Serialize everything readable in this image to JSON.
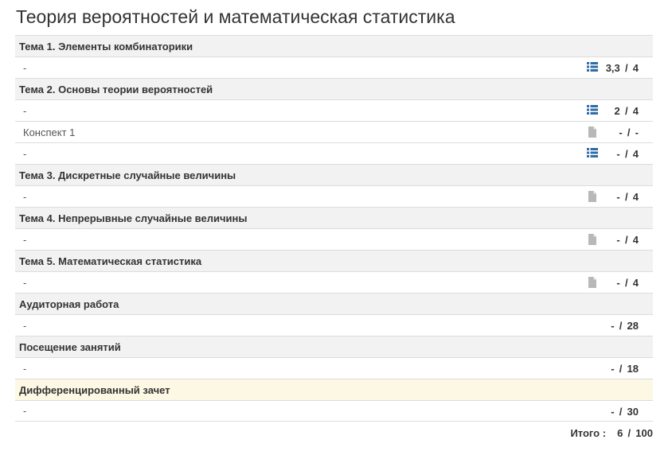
{
  "title": "Теория вероятностей и математическая статистика",
  "rows": [
    {
      "kind": "section",
      "label": "Тема 1. Элементы комбинаторики"
    },
    {
      "kind": "item",
      "label": "-",
      "icon": "list-icon",
      "got": "3,3",
      "max": "4"
    },
    {
      "kind": "section",
      "label": "Тема 2. Основы теории вероятностей"
    },
    {
      "kind": "item",
      "label": "-",
      "icon": "list-icon",
      "got": "2",
      "max": "4"
    },
    {
      "kind": "item",
      "label": "Конспект 1",
      "icon": "document-icon",
      "got": "-",
      "max": "-"
    },
    {
      "kind": "item",
      "label": "-",
      "icon": "list-icon",
      "got": "-",
      "max": "4"
    },
    {
      "kind": "section",
      "label": "Тема 3. Дискретные случайные величины"
    },
    {
      "kind": "item",
      "label": "-",
      "icon": "document-icon",
      "got": "-",
      "max": "4"
    },
    {
      "kind": "section",
      "label": "Тема 4. Непрерывные случайные величины"
    },
    {
      "kind": "item",
      "label": "-",
      "icon": "document-icon",
      "got": "-",
      "max": "4"
    },
    {
      "kind": "section",
      "label": "Тема 5. Математическая статистика"
    },
    {
      "kind": "item",
      "label": "-",
      "icon": "document-icon",
      "got": "-",
      "max": "4"
    },
    {
      "kind": "section",
      "label": "Аудиторная работа"
    },
    {
      "kind": "item",
      "label": "-",
      "icon": "",
      "got": "-",
      "max": "28"
    },
    {
      "kind": "section",
      "label": "Посещение занятий"
    },
    {
      "kind": "item",
      "label": "-",
      "icon": "",
      "got": "-",
      "max": "18"
    },
    {
      "kind": "section",
      "label": "Дифференцированный зачет",
      "highlight": true
    },
    {
      "kind": "item",
      "label": "-",
      "icon": "",
      "got": "-",
      "max": "30"
    }
  ],
  "total": {
    "label": "Итого :",
    "got": "6",
    "max": "100"
  },
  "colors": {
    "list_icon": "#2e6da4",
    "document_icon": "#b8b8b8",
    "section_bg": "#f2f2f2",
    "highlight_bg": "#fcf8e3"
  }
}
